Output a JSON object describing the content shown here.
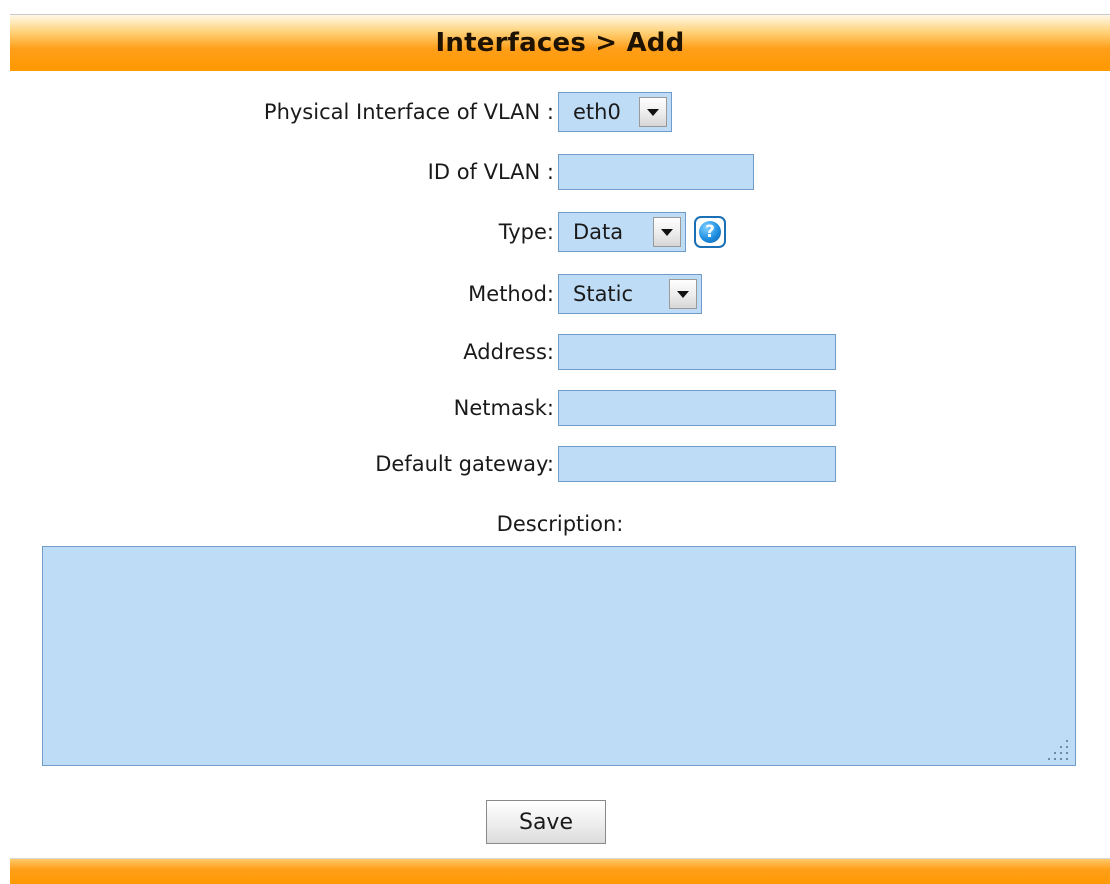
{
  "header": {
    "title": "Interfaces > Add"
  },
  "form": {
    "physical_interface": {
      "label": "Physical Interface of VLAN :",
      "selected": "eth0"
    },
    "vlan_id": {
      "label": "ID of VLAN :",
      "value": ""
    },
    "type": {
      "label": "Type:",
      "selected": "Data",
      "help_icon": "help-question-icon"
    },
    "method": {
      "label": "Method:",
      "selected": "Static"
    },
    "address": {
      "label": "Address:",
      "value": ""
    },
    "netmask": {
      "label": "Netmask:",
      "value": ""
    },
    "gateway": {
      "label": "Default gateway:",
      "value": ""
    },
    "description": {
      "label": "Description:",
      "value": ""
    },
    "save_label": "Save"
  },
  "colors": {
    "accent_orange": "#ff9900",
    "field_background": "#bfdcf7",
    "field_border": "#6f9cc8",
    "help_blue": "#1f8fe0"
  }
}
